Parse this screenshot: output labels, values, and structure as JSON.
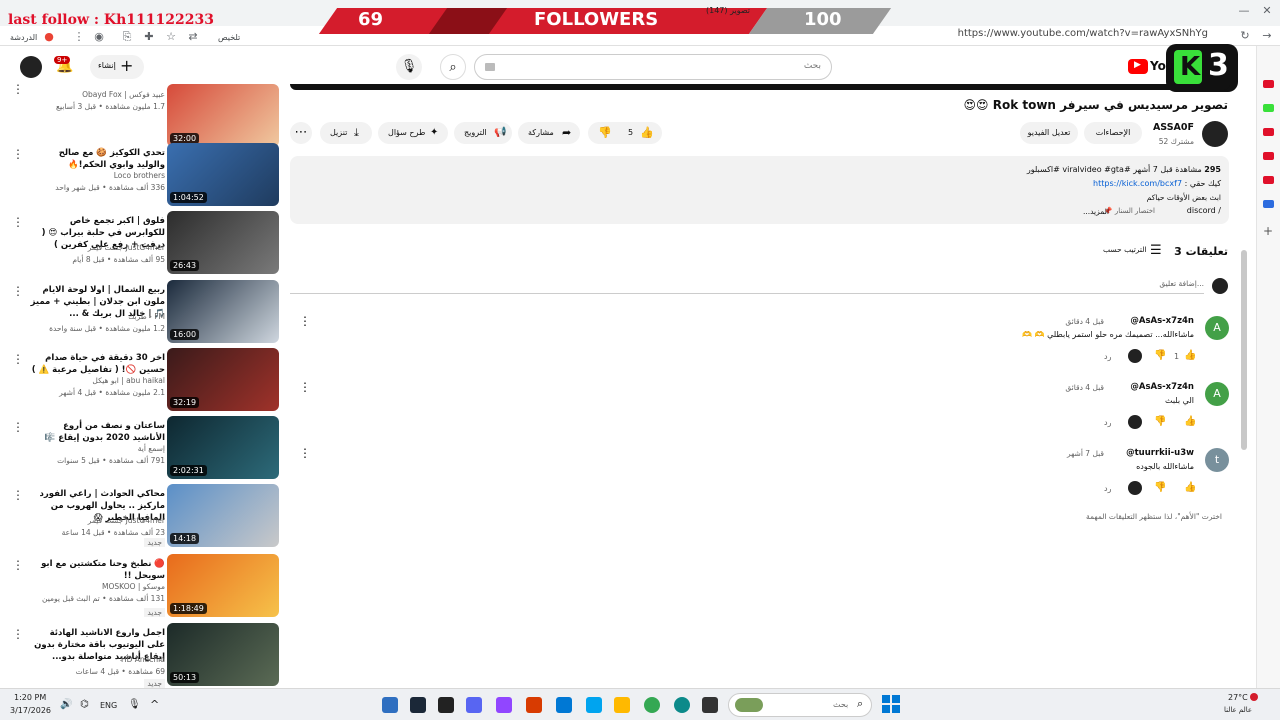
{
  "overlay": {
    "stream_tag": "last follow : Kh111122233",
    "count_left": "69",
    "label": "FOLLOWERS",
    "count_right": "100",
    "behind_text": "(147) تصوير"
  },
  "browser": {
    "url": "https://www.youtube.com/watch?v=rawAyxSNhYg",
    "bookmark_label": "الدردشة",
    "summary_label": "تلخيص"
  },
  "header": {
    "search_placeholder": "بحث",
    "create_label": "إنشاء",
    "notif_badge": "9+",
    "brand_short": "You",
    "logo_text": "3"
  },
  "video": {
    "title": "تصوير مرسيديس في سيرفر Rok town 😍😍",
    "channel": "ASSA0F",
    "subscribers": "52 مشترك",
    "stats_button": "الإحصاءات",
    "edit_button": "تعديل الفيديو",
    "like_count": "5",
    "share_label": "مشاركة",
    "promote_label": "الترويج",
    "ask_label": "طرح سؤال",
    "download_label": "تنزيل"
  },
  "description": {
    "views": "295",
    "meta": "مشاهدة قبل 7 أشهر #viralvideo #gta #اكسبلور",
    "line2_label": "كيك حقي :",
    "link": "https://kick.com/bcxf7",
    "line3": "ابث بعض الأوقات حياكم",
    "discord": "discord /",
    "more": "...المزيد",
    "shortcut": "اختصار السنار"
  },
  "comments": {
    "count_label": "3 تعليقات",
    "sort_label": "الترتيب حسب",
    "add_placeholder": "إضافة تعليق...",
    "items": [
      {
        "user": "@AsAs-x7z4n",
        "time": "قبل 4 دقائق",
        "text": "ماشاءالله... تصميمك مره حلو استمر يابطلي 🫶 🫶",
        "likes": "1",
        "reply": "رد",
        "avatar_letter": "A",
        "avatar_color": "#43a047"
      },
      {
        "user": "@AsAs-x7z4n",
        "time": "قبل 4 دقائق",
        "text": "الي بلبث",
        "likes": "",
        "reply": "رد",
        "avatar_letter": "A",
        "avatar_color": "#43a047"
      },
      {
        "user": "@tuurrkii-u3w",
        "time": "قبل 7 أشهر",
        "text": "ماشاءالله بالجوده",
        "likes": "",
        "reply": "رد",
        "avatar_letter": "t",
        "avatar_color": "#78909c"
      }
    ],
    "footer": "اخترت \"الأهم\"، لذا ستظهر التعليقات المهمة"
  },
  "sidebar_videos": [
    {
      "title": "",
      "channel": "Obayd Fox | عبيد فوكس",
      "meta": "1.7 مليون مشاهدة • قبل 3 أسابيع",
      "duration": "32:00",
      "colors": [
        "#d64a3a",
        "#f0c9a0"
      ]
    },
    {
      "title": "تحدي الكوكيز 🍪 مع صالح والوليد وابوي الحكم!🔥",
      "channel": "Loco brothers",
      "meta": "336 ألف مشاهدة • قبل شهر واحد",
      "duration": "1:04:52",
      "colors": [
        "#3a6fb0",
        "#1f3b5e"
      ]
    },
    {
      "title": "فلوق | اكبر تجمع خاص للكوابرس في حلبة بيراب 😍 ( درفت + رفع على كفرين )",
      "channel": "جست قيمر JustG4mer",
      "meta": "95 ألف مشاهدة • قبل 8 أيام",
      "duration": "26:43",
      "colors": [
        "#2c2c2c",
        "#7a7a7a"
      ]
    },
    {
      "title": "ربيع الشمال | اولا لوحة الايام ملون ابن جدلان | بطيني + مميز 🎵 | خالد ال بريك & ...",
      "channel": "طربك - FM",
      "meta": "1.2 مليون مشاهدة • قبل سنة واحدة",
      "duration": "16:00",
      "colors": [
        "#1b2a3c",
        "#cfd7df"
      ]
    },
    {
      "title": "اخر 30 دقيقة في حياة صدام حسين 🚫! ( تفاصيل مرعبة ⚠️ )",
      "channel": "ابو هيكل | abu haikal",
      "meta": "2.1 مليون مشاهدة • قبل 4 أشهر",
      "duration": "32:19",
      "colors": [
        "#3a1a1a",
        "#a0322a"
      ]
    },
    {
      "title": "ساعتان و نصف من أروع الأناشيد 2020 بدون إيقاع 🎼",
      "channel": "إسمع أية",
      "meta": "791 ألف مشاهدة • قبل 5 سنوات",
      "duration": "2:02:31",
      "colors": [
        "#0e2730",
        "#2d6b7a"
      ]
    },
    {
      "title": "محاكي الحوادث | راعي الفورد ماركيز .. يحاول الهروب من المافيا الخطير 😱",
      "channel": "جست قيمر JustG4mer",
      "meta": "23 ألف مشاهدة • قبل 14 ساعة",
      "duration": "14:18",
      "colors": [
        "#5a8fc8",
        "#c9c9c9"
      ]
    },
    {
      "title": "🔴 نطبخ وحنا متكشتين مع ابو سويحل !!",
      "channel": "MOSKOO | موسكو",
      "meta": "131 ألف مشاهدة • تم البث قبل يومين",
      "duration": "1:18:49",
      "colors": [
        "#e86a1c",
        "#f6c24a"
      ]
    },
    {
      "title": "اجمل واروع الاناشيد الهادئة على اليوتيوب باقة مختارة بدون إيقاع أناشيد متواصلة بدو...",
      "channel": "HD Anachid",
      "meta": "69 مشاهدة • قبل 4 ساعات",
      "duration": "50:13",
      "colors": [
        "#1c2a28",
        "#5b6b55"
      ]
    }
  ],
  "badges": {
    "new": "جديد"
  },
  "taskbar": {
    "time": "1:20 PM",
    "date": "3/17/2026",
    "lang": "ENG",
    "search_placeholder": "بحث",
    "temp": "27°C",
    "weather": "عالم عالنا"
  }
}
